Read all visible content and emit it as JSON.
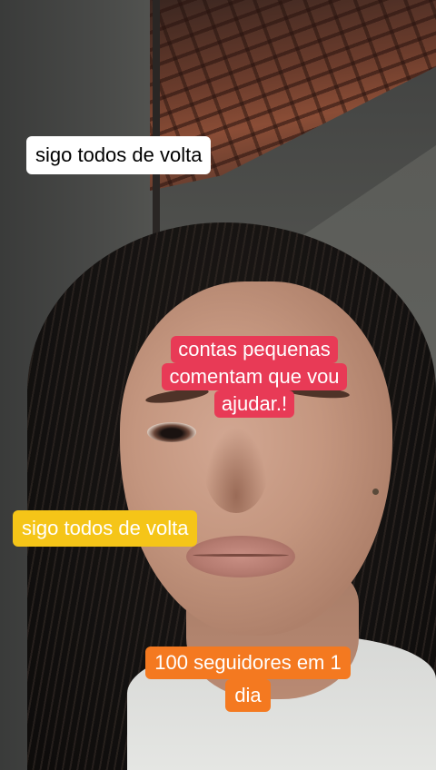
{
  "captions": {
    "top_white": "sigo todos de volta",
    "red_line_1": "contas pequenas",
    "red_line_2": "comentam que vou",
    "red_line_3": "ajudar.!",
    "yellow": "sigo todos de volta",
    "orange_line_1": "100 seguidores em 1",
    "orange_line_2": "dia"
  },
  "colors": {
    "white_caption_bg": "#ffffff",
    "red_caption_bg": "#e83a56",
    "yellow_caption_bg": "#f5c518",
    "orange_caption_bg": "#f47920",
    "caption_text_light": "#ffffff",
    "caption_text_dark": "#000000"
  }
}
